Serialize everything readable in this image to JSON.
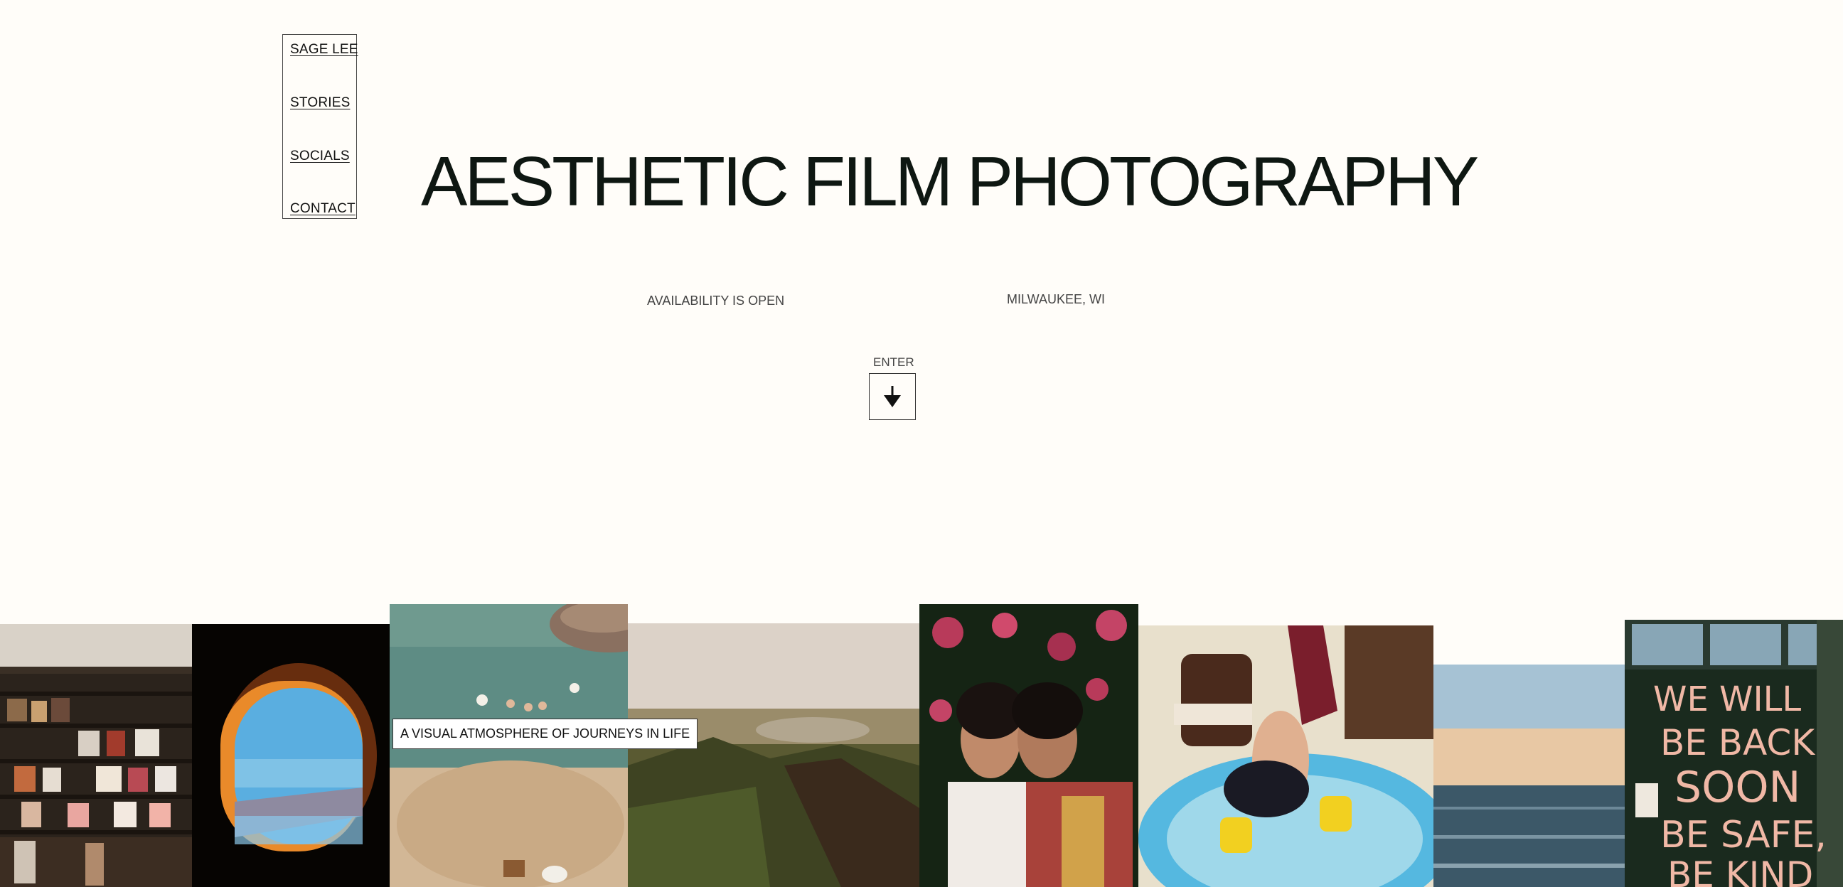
{
  "nav": {
    "items": [
      {
        "label": "SAGE LEE"
      },
      {
        "label": "STORIES"
      },
      {
        "label": "SOCIALS"
      },
      {
        "label": "CONTACT"
      }
    ]
  },
  "hero": {
    "title": "AESTHETIC FILM PHOTOGRAPHY",
    "availability": "AVAILABILITY IS OPEN",
    "location": "MILWAUKEE, WI",
    "enter_label": "ENTER"
  },
  "gallery": {
    "caption": "A VISUAL ATMOSPHERE OF JOURNEYS IN LIFE",
    "graffiti_lines": [
      "WE WILL",
      "BE BACK",
      "SOON",
      "BE SAFE,",
      "BE KIND"
    ]
  },
  "colors": {
    "background": "#fffdf9",
    "text": "#0e1712"
  }
}
